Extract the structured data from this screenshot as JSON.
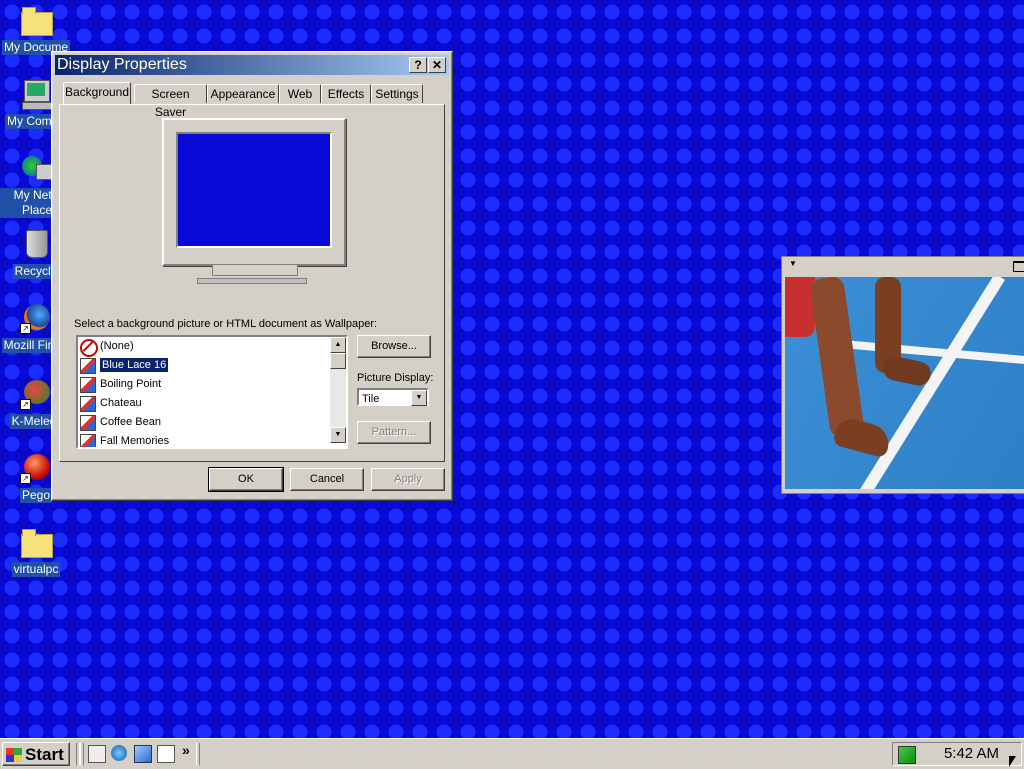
{
  "desktop": {
    "icons": [
      {
        "label": "My Docume",
        "icon": "my-documents-icon"
      },
      {
        "label": "My Compu",
        "icon": "my-computer-icon"
      },
      {
        "label": "My Netw Place",
        "icon": "network-places-icon"
      },
      {
        "label": "Recycle",
        "icon": "recycle-bin-icon"
      },
      {
        "label": "Mozill Firefo",
        "icon": "firefox-icon"
      },
      {
        "label": "K-Meleor",
        "icon": "k-meleon-icon"
      },
      {
        "label": "Pego",
        "icon": "pego-icon"
      },
      {
        "label": "virtualpc",
        "icon": "folder-icon"
      }
    ]
  },
  "dialog": {
    "title": "Display Properties",
    "help_btn": "?",
    "close_btn": "✕",
    "tabs": [
      "Background",
      "Screen Saver",
      "Appearance",
      "Web",
      "Effects",
      "Settings"
    ],
    "active_tab": "Background",
    "wallpaper_label": "Select a background picture or HTML document as Wallpaper:",
    "wallpapers": [
      "(None)",
      "Blue Lace 16",
      "Boiling Point",
      "Chateau",
      "Coffee Bean",
      "Fall Memories"
    ],
    "selected_wallpaper": "Blue Lace 16",
    "browse_label": "Browse...",
    "picture_display_label": "Picture Display:",
    "picture_display_value": "Tile",
    "pattern_label": "Pattern...",
    "ok_label": "OK",
    "cancel_label": "Cancel",
    "apply_label": "Apply",
    "preview_color": "#0a0ad8"
  },
  "taskbar": {
    "start_label": "Start",
    "chevron": "»",
    "clock": "5:42 AM"
  }
}
